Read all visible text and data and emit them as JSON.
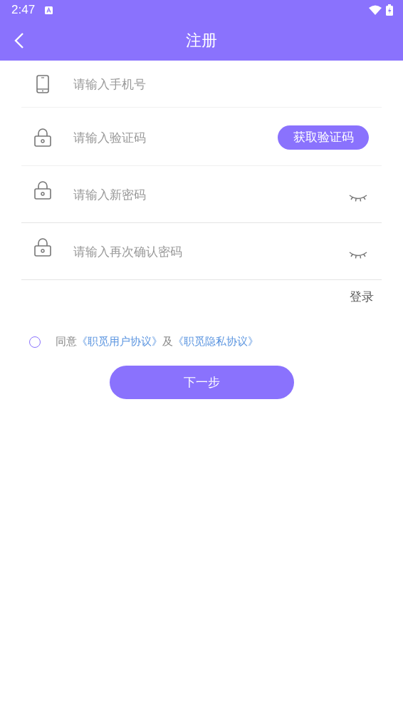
{
  "status_bar": {
    "time": "2:47"
  },
  "header": {
    "title": "注册"
  },
  "fields": [
    {
      "kind": "phone",
      "placeholder": "请输入手机号"
    },
    {
      "kind": "code",
      "placeholder": "请输入验证码",
      "button": "获取验证码"
    },
    {
      "kind": "password",
      "placeholder": "请输入新密码"
    },
    {
      "kind": "password",
      "placeholder": "请输入再次确认密码"
    }
  ],
  "login_link": "登录",
  "agreement": {
    "checked": false,
    "prefix": "同意",
    "link_1": "《职觅用户协议》",
    "middle": "及",
    "link_2": "《职觅隐私协议》"
  },
  "next_button": "下一步"
}
